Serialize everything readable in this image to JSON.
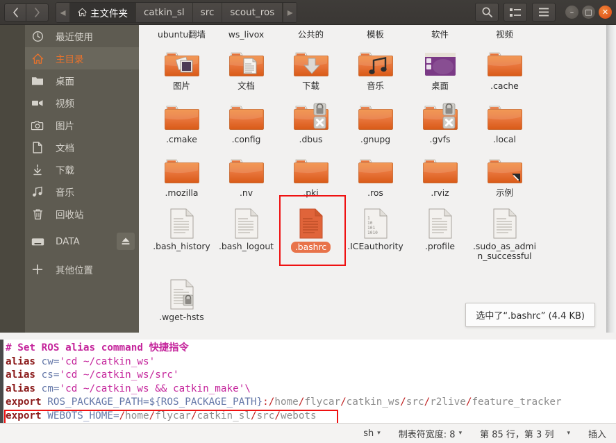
{
  "window": {
    "back_tooltip": "Back",
    "forward_tooltip": "Forward",
    "search_icon": "search-icon",
    "viewlist_icon": "list-view-icon",
    "menu_icon": "hamburger-menu-icon",
    "minimize_label": "–",
    "maximize_label": "□",
    "close_label": "✕"
  },
  "breadcrumb": {
    "left_arrow": "◂",
    "right_arrow": "▸",
    "items": [
      {
        "label": "主文件夹",
        "icon": "home-icon",
        "active": true
      },
      {
        "label": "catkin_sl",
        "icon": "",
        "active": false
      },
      {
        "label": "src",
        "icon": "",
        "active": false
      },
      {
        "label": "scout_ros",
        "icon": "",
        "active": false
      }
    ]
  },
  "sidebar": {
    "items": [
      {
        "label": "最近使用",
        "icon": "clock-icon",
        "active": false
      },
      {
        "label": "主目录",
        "icon": "home-icon",
        "active": true
      },
      {
        "label": "桌面",
        "icon": "folder-icon",
        "active": false
      },
      {
        "label": "视频",
        "icon": "video-icon",
        "active": false
      },
      {
        "label": "图片",
        "icon": "camera-icon",
        "active": false
      },
      {
        "label": "文档",
        "icon": "document-icon",
        "active": false
      },
      {
        "label": "下载",
        "icon": "download-icon",
        "active": false
      },
      {
        "label": "音乐",
        "icon": "music-icon",
        "active": false
      },
      {
        "label": "回收站",
        "icon": "trash-icon",
        "active": false
      },
      {
        "label": "DATA",
        "icon": "drive-icon",
        "active": false,
        "eject": true
      },
      {
        "label": "其他位置",
        "icon": "plus-icon",
        "active": false
      }
    ]
  },
  "files": {
    "row_partial": [
      {
        "label": "ubuntu翻墙",
        "type": "folder"
      },
      {
        "label": "ws_livox",
        "type": "folder"
      },
      {
        "label": "公共的",
        "type": "folder"
      },
      {
        "label": "模板",
        "type": "folder"
      },
      {
        "label": "软件",
        "type": "folder"
      },
      {
        "label": "视频",
        "type": "folder"
      }
    ],
    "row1": [
      {
        "label": "图片",
        "type": "folder-pictures"
      },
      {
        "label": "文档",
        "type": "folder-documents"
      },
      {
        "label": "下载",
        "type": "folder-downloads"
      },
      {
        "label": "音乐",
        "type": "folder-music"
      },
      {
        "label": "桌面",
        "type": "folder-desktop"
      },
      {
        "label": ".cache",
        "type": "folder"
      }
    ],
    "row2": [
      {
        "label": ".cmake",
        "type": "folder"
      },
      {
        "label": ".config",
        "type": "folder"
      },
      {
        "label": ".dbus",
        "type": "folder-locked"
      },
      {
        "label": ".gnupg",
        "type": "folder"
      },
      {
        "label": ".gvfs",
        "type": "folder-locked"
      },
      {
        "label": ".local",
        "type": "folder"
      }
    ],
    "row3": [
      {
        "label": ".mozilla",
        "type": "folder"
      },
      {
        "label": ".nv",
        "type": "folder"
      },
      {
        "label": ".pki",
        "type": "folder"
      },
      {
        "label": ".ros",
        "type": "folder"
      },
      {
        "label": ".rviz",
        "type": "folder"
      },
      {
        "label": "示例",
        "type": "folder-link"
      }
    ],
    "row4": [
      {
        "label": ".bash_history",
        "type": "text-file"
      },
      {
        "label": ".bash_logout",
        "type": "text-file"
      },
      {
        "label": ".bashrc",
        "type": "text-file-selected",
        "selected": true
      },
      {
        "label": ".ICEauthority",
        "type": "binary-file"
      },
      {
        "label": ".profile",
        "type": "text-file"
      },
      {
        "label": ".sudo_as_admin_successful",
        "type": "text-file"
      }
    ],
    "row5": [
      {
        "label": ".wget-hsts",
        "type": "text-file-locked"
      }
    ],
    "status_popup": "选中了“.bashrc” (4.4 KB)"
  },
  "editor": {
    "lines": [
      {
        "tokens": [
          {
            "t": "# Set ROS alias command 快捷指令",
            "c": "k-comment"
          }
        ]
      },
      {
        "tokens": [
          {
            "t": "alias",
            "c": "k-kw"
          },
          {
            "t": " cw=",
            "c": "k-var"
          },
          {
            "t": "'cd ~/catkin_ws'",
            "c": "k-str"
          }
        ]
      },
      {
        "tokens": [
          {
            "t": "alias",
            "c": "k-kw"
          },
          {
            "t": " cs=",
            "c": "k-var"
          },
          {
            "t": "'cd ~/catkin_ws/src'",
            "c": "k-str"
          }
        ]
      },
      {
        "tokens": [
          {
            "t": "alias",
            "c": "k-kw"
          },
          {
            "t": " cm=",
            "c": "k-var"
          },
          {
            "t": "'cd ~/catkin_ws && catkin_make'\\",
            "c": "k-str"
          }
        ]
      },
      {
        "tokens": [
          {
            "t": "export",
            "c": "k-kw"
          },
          {
            "t": " ROS_PACKAGE_PATH=${ROS_PACKAGE_PATH}",
            "c": "k-var"
          },
          {
            "t": ":",
            "c": "k-sep"
          },
          {
            "t": "/",
            "c": "k-sep"
          },
          {
            "t": "home",
            "c": "k-path"
          },
          {
            "t": "/",
            "c": "k-sep"
          },
          {
            "t": "flycar",
            "c": "k-path"
          },
          {
            "t": "/",
            "c": "k-sep"
          },
          {
            "t": "catkin_ws",
            "c": "k-path"
          },
          {
            "t": "/",
            "c": "k-sep"
          },
          {
            "t": "src",
            "c": "k-path"
          },
          {
            "t": "/",
            "c": "k-sep"
          },
          {
            "t": "r2live",
            "c": "k-path"
          },
          {
            "t": "/",
            "c": "k-sep"
          },
          {
            "t": "feature_tracker",
            "c": "k-path"
          }
        ]
      },
      {
        "tokens": [
          {
            "t": "export",
            "c": "k-kw"
          },
          {
            "t": " WEBOTS_HOME=",
            "c": "k-var"
          },
          {
            "t": "/",
            "c": "k-sep"
          },
          {
            "t": "home",
            "c": "k-path"
          },
          {
            "t": "/",
            "c": "k-sep"
          },
          {
            "t": "flycar",
            "c": "k-path"
          },
          {
            "t": "/",
            "c": "k-sep"
          },
          {
            "t": "catkin_sl",
            "c": "k-path"
          },
          {
            "t": "/",
            "c": "k-sep"
          },
          {
            "t": "src",
            "c": "k-path"
          },
          {
            "t": "/",
            "c": "k-sep"
          },
          {
            "t": "webots",
            "c": "k-path"
          }
        ]
      }
    ]
  },
  "statusbar": {
    "language": "sh",
    "tabwidth": "制表符宽度: 8",
    "position": "第 85 行，第 3 列",
    "mode": "插入",
    "caret": "▾"
  }
}
